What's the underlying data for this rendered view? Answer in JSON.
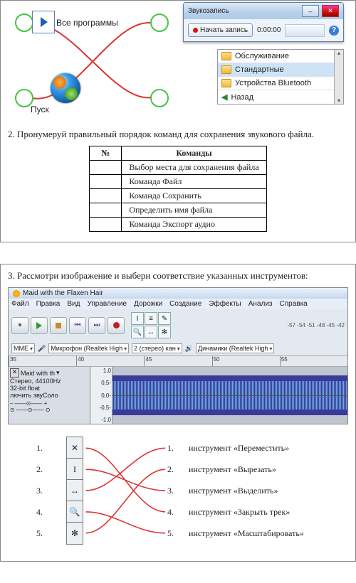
{
  "task1": {
    "all_programs": "Все программы",
    "start": "Пуск",
    "rec_window": {
      "title": "Звукозапись",
      "start_rec": "Начать запись",
      "time": "0:00:00"
    },
    "nav": {
      "items": [
        "Обслуживание",
        "Стандартные",
        "Устройства Bluetooth"
      ],
      "back": "Назад"
    }
  },
  "task2": {
    "question": "2.   Пронумеруй правильный порядок команд для сохранения звукового файла.",
    "head_num": "№",
    "head_cmd": "Команды",
    "rows": [
      "Выбор места для сохранения файла",
      "Команда Файл",
      "Команда Сохранить",
      "Определить имя файла",
      "Команда Экспорт аудио"
    ]
  },
  "task3": {
    "question": "3. Рассмотри изображение и выбери соответствие указанных инструментов:",
    "title": "Maid with the Flaxen Hair",
    "menu": [
      "Файл",
      "Правка",
      "Вид",
      "Управление",
      "Дорожки",
      "Создание",
      "Эффекты",
      "Анализ",
      "Справка"
    ],
    "host": "MME",
    "mic": "Микрофон (Realtek High",
    "chan": "2 (стерео) кан",
    "spk": "Динамики (Realtek High",
    "ruler": [
      "35",
      "40",
      "45",
      "50",
      "55"
    ],
    "track_name": "Maid with th",
    "track_fmt1": "Стерео, 44100Hz",
    "track_fmt2": "32-bit float",
    "track_solo": "лючить звуСоло",
    "scale": [
      "1,0",
      "0,5-",
      "0,0-",
      "-0,5-",
      "-1,0"
    ],
    "db_ticks": "-57 -54 -51 -48 -45 -42",
    "left_nums": [
      "1.",
      "2.",
      "3.",
      "4.",
      "5."
    ],
    "icons": [
      "✕",
      "I",
      "↔",
      "🔍",
      "✻"
    ],
    "right_nums": [
      "1.",
      "2.",
      "3.",
      "4.",
      "5."
    ],
    "right_labels": [
      "инструмент «Переместить»",
      "инструмент «Вырезать»",
      "инструмент «Выделить»",
      "инструмент «Закрыть трек»",
      "инструмент «Масштабировать»"
    ]
  }
}
